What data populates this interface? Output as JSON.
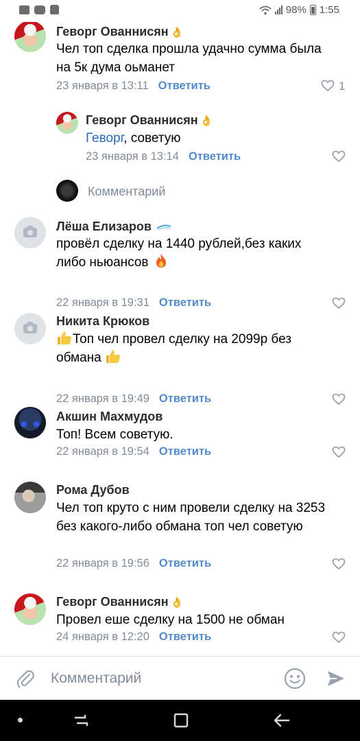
{
  "status_bar": {
    "left_icons": [
      "gallery-icon",
      "youtube-icon",
      "shopping-bag-icon"
    ],
    "battery": "98%",
    "time": "1:55"
  },
  "comments": [
    {
      "author": "Геворг Ованнисян",
      "emoji": "👌",
      "text": "Чел топ сделка прошла удачно сумма была на 5к дума оьманет",
      "date": "23 января в 13:11",
      "reply_label": "Ответить",
      "likes": "1"
    },
    {
      "author": "Геворг Ованнисян",
      "emoji": "👌",
      "mention": "Геворг",
      "text": ", советую",
      "date": "23 января в 13:14",
      "reply_label": "Ответить"
    },
    {
      "author": "Лёша Елизаров",
      "text": "провёл сделку на 1440 рублей,без каких либо ньюансов",
      "date": "22 января в 19:31",
      "reply_label": "Ответить"
    },
    {
      "author": "Никита Крюков",
      "text": "Топ чел провел сделку на 2099р без обмана",
      "date": "22 января в 19:49",
      "reply_label": "Ответить"
    },
    {
      "author": "Акшин Махмудов",
      "text": "Топ! Всем советую.",
      "date": "22 января в 19:54",
      "reply_label": "Ответить"
    },
    {
      "author": "Рома Дубов",
      "text": "Чел топ круто с ним провели сделку на 3253 без какого-либо обмана топ чел советую",
      "date": "22 января в 19:56",
      "reply_label": "Ответить"
    },
    {
      "author": "Геворг Ованнисян",
      "emoji": "👌",
      "text": "Провел еше сделку на 1500 не обман",
      "date": "24 января в 12:20",
      "reply_label": "Ответить"
    }
  ],
  "reply_input": {
    "placeholder": "Комментарий"
  },
  "composer": {
    "placeholder": "Комментарий"
  },
  "colors": {
    "accent": "#528bcc",
    "link": "#2a6bbf",
    "meta": "#818c99",
    "navbar": "#000000"
  }
}
